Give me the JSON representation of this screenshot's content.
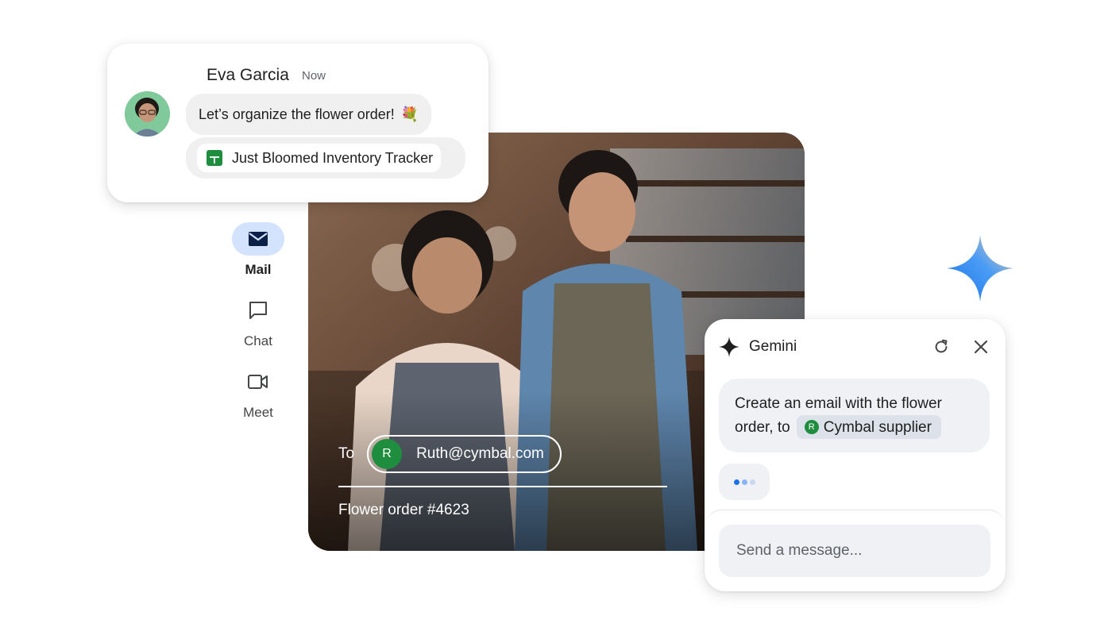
{
  "chat": {
    "sender_name": "Eva Garcia",
    "timestamp": "Now",
    "message": "Let’s organize the flower order!",
    "message_emoji": "💐",
    "attachment_name": "Just Bloomed Inventory Tracker"
  },
  "nav": {
    "items": [
      {
        "label": "Mail",
        "icon": "mail-icon",
        "active": true
      },
      {
        "label": "Chat",
        "icon": "chat-icon",
        "active": false
      },
      {
        "label": "Meet",
        "icon": "meet-icon",
        "active": false
      }
    ]
  },
  "email": {
    "to_label": "To",
    "recipient_initial": "R",
    "recipient": "Ruth@cymbal.com",
    "subject": "Flower order #4623"
  },
  "gemini": {
    "title": "Gemini",
    "prompt_line1": "Create an email with the flower",
    "prompt_line2": "order, to",
    "supplier_initial": "R",
    "supplier_chip": "Cymbal supplier",
    "input_placeholder": "Send a message..."
  },
  "colors": {
    "accent_blue": "#4285f4",
    "nav_active": "#d3e3fd",
    "sheets_green": "#1e8e3e",
    "avatar_green": "#1e8e3e"
  }
}
